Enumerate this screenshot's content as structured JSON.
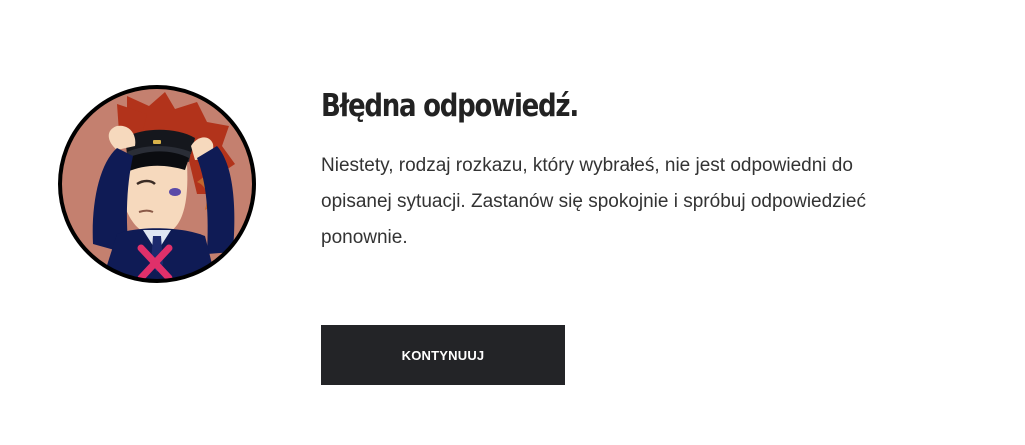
{
  "feedback": {
    "title": "Błędna odpowiedź.",
    "message": "Niestety, rodzaj rozkazu, który wybrałeś, nie jest odpowiedni do opisanej sytuacji. Zastanów się spokojnie i spróbuj odpowiedzieć ponownie.",
    "continue_label": "KONTYNUUJ",
    "avatar_icon": "wrong-answer-officer-icon"
  },
  "colors": {
    "button_background": "#232427",
    "button_text": "#ffffff",
    "title_text": "#222222",
    "body_text": "#333333",
    "avatar_background": "#c4806f",
    "avatar_border": "#000000",
    "cross_mark": "#e0306a"
  }
}
